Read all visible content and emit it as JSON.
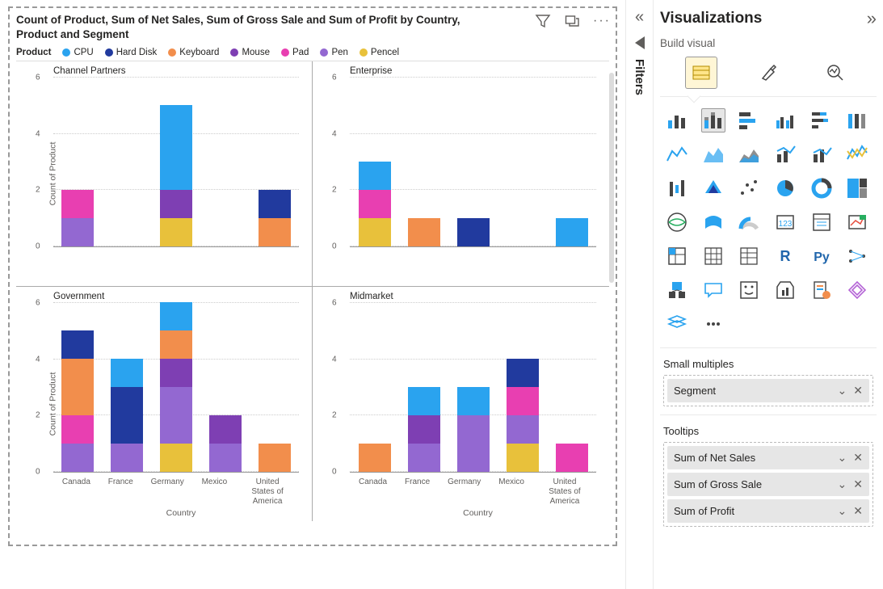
{
  "visual": {
    "title": "Count of Product, Sum of Net Sales, Sum of Gross Sale and Sum of Profit by Country, Product and Segment",
    "legend_title": "Product"
  },
  "products": [
    {
      "name": "CPU",
      "color": "#2aa3ef"
    },
    {
      "name": "Hard Disk",
      "color": "#213a9e"
    },
    {
      "name": "Keyboard",
      "color": "#f28e4c"
    },
    {
      "name": "Mouse",
      "color": "#7e3fb3"
    },
    {
      "name": "Pad",
      "color": "#e83fb1"
    },
    {
      "name": "Pen",
      "color": "#9368d1"
    },
    {
      "name": "Pencel",
      "color": "#e8c13b"
    }
  ],
  "countries": [
    "Canada",
    "France",
    "Germany",
    "Mexico",
    "United States of America"
  ],
  "y_axis": {
    "label": "Count of Product",
    "max": 6,
    "ticks": [
      0,
      2,
      4,
      6
    ]
  },
  "x_axis_label": "Country",
  "chart_data": [
    {
      "segment": "Channel Partners",
      "bars": {
        "Canada": {
          "Pad": 1,
          "Pen": 1
        },
        "France": {},
        "Germany": {
          "CPU": 3,
          "Mouse": 1,
          "Pencel": 1
        },
        "Mexico": {},
        "United States of America": {
          "Hard Disk": 1,
          "Keyboard": 1
        }
      }
    },
    {
      "segment": "Enterprise",
      "bars": {
        "Canada": {
          "CPU": 1,
          "Pad": 1,
          "Pencel": 1
        },
        "France": {
          "Keyboard": 1
        },
        "Germany": {
          "Hard Disk": 1
        },
        "Mexico": {},
        "United States of America": {
          "CPU": 1
        }
      }
    },
    {
      "segment": "Government",
      "bars": {
        "Canada": {
          "Hard Disk": 1,
          "Keyboard": 2,
          "Pad": 1,
          "Pen": 1
        },
        "France": {
          "CPU": 1,
          "Hard Disk": 2,
          "Pen": 1
        },
        "Germany": {
          "CPU": 1,
          "Keyboard": 1,
          "Mouse": 1,
          "Pen": 2,
          "Pencel": 1
        },
        "Mexico": {
          "Mouse": 1,
          "Pen": 1
        },
        "United States of America": {
          "Keyboard": 1
        }
      }
    },
    {
      "segment": "Midmarket",
      "bars": {
        "Canada": {
          "Keyboard": 1
        },
        "France": {
          "CPU": 1,
          "Mouse": 1,
          "Pen": 1
        },
        "Germany": {
          "CPU": 1,
          "Pen": 2
        },
        "Mexico": {
          "Hard Disk": 1,
          "Pad": 1,
          "Pen": 1,
          "Pencel": 1
        },
        "United States of America": {
          "Pad": 1
        }
      }
    }
  ],
  "panel": {
    "title": "Visualizations",
    "build_label": "Build visual",
    "filters_label": "Filters"
  },
  "field_sections": [
    {
      "title": "Small multiples",
      "pills": [
        "Segment"
      ]
    },
    {
      "title": "Tooltips",
      "pills": [
        "Sum of Net Sales",
        "Sum of Gross Sale",
        "Sum of Profit"
      ]
    }
  ],
  "gallery_selected_index": 1,
  "gallery_count": 38
}
